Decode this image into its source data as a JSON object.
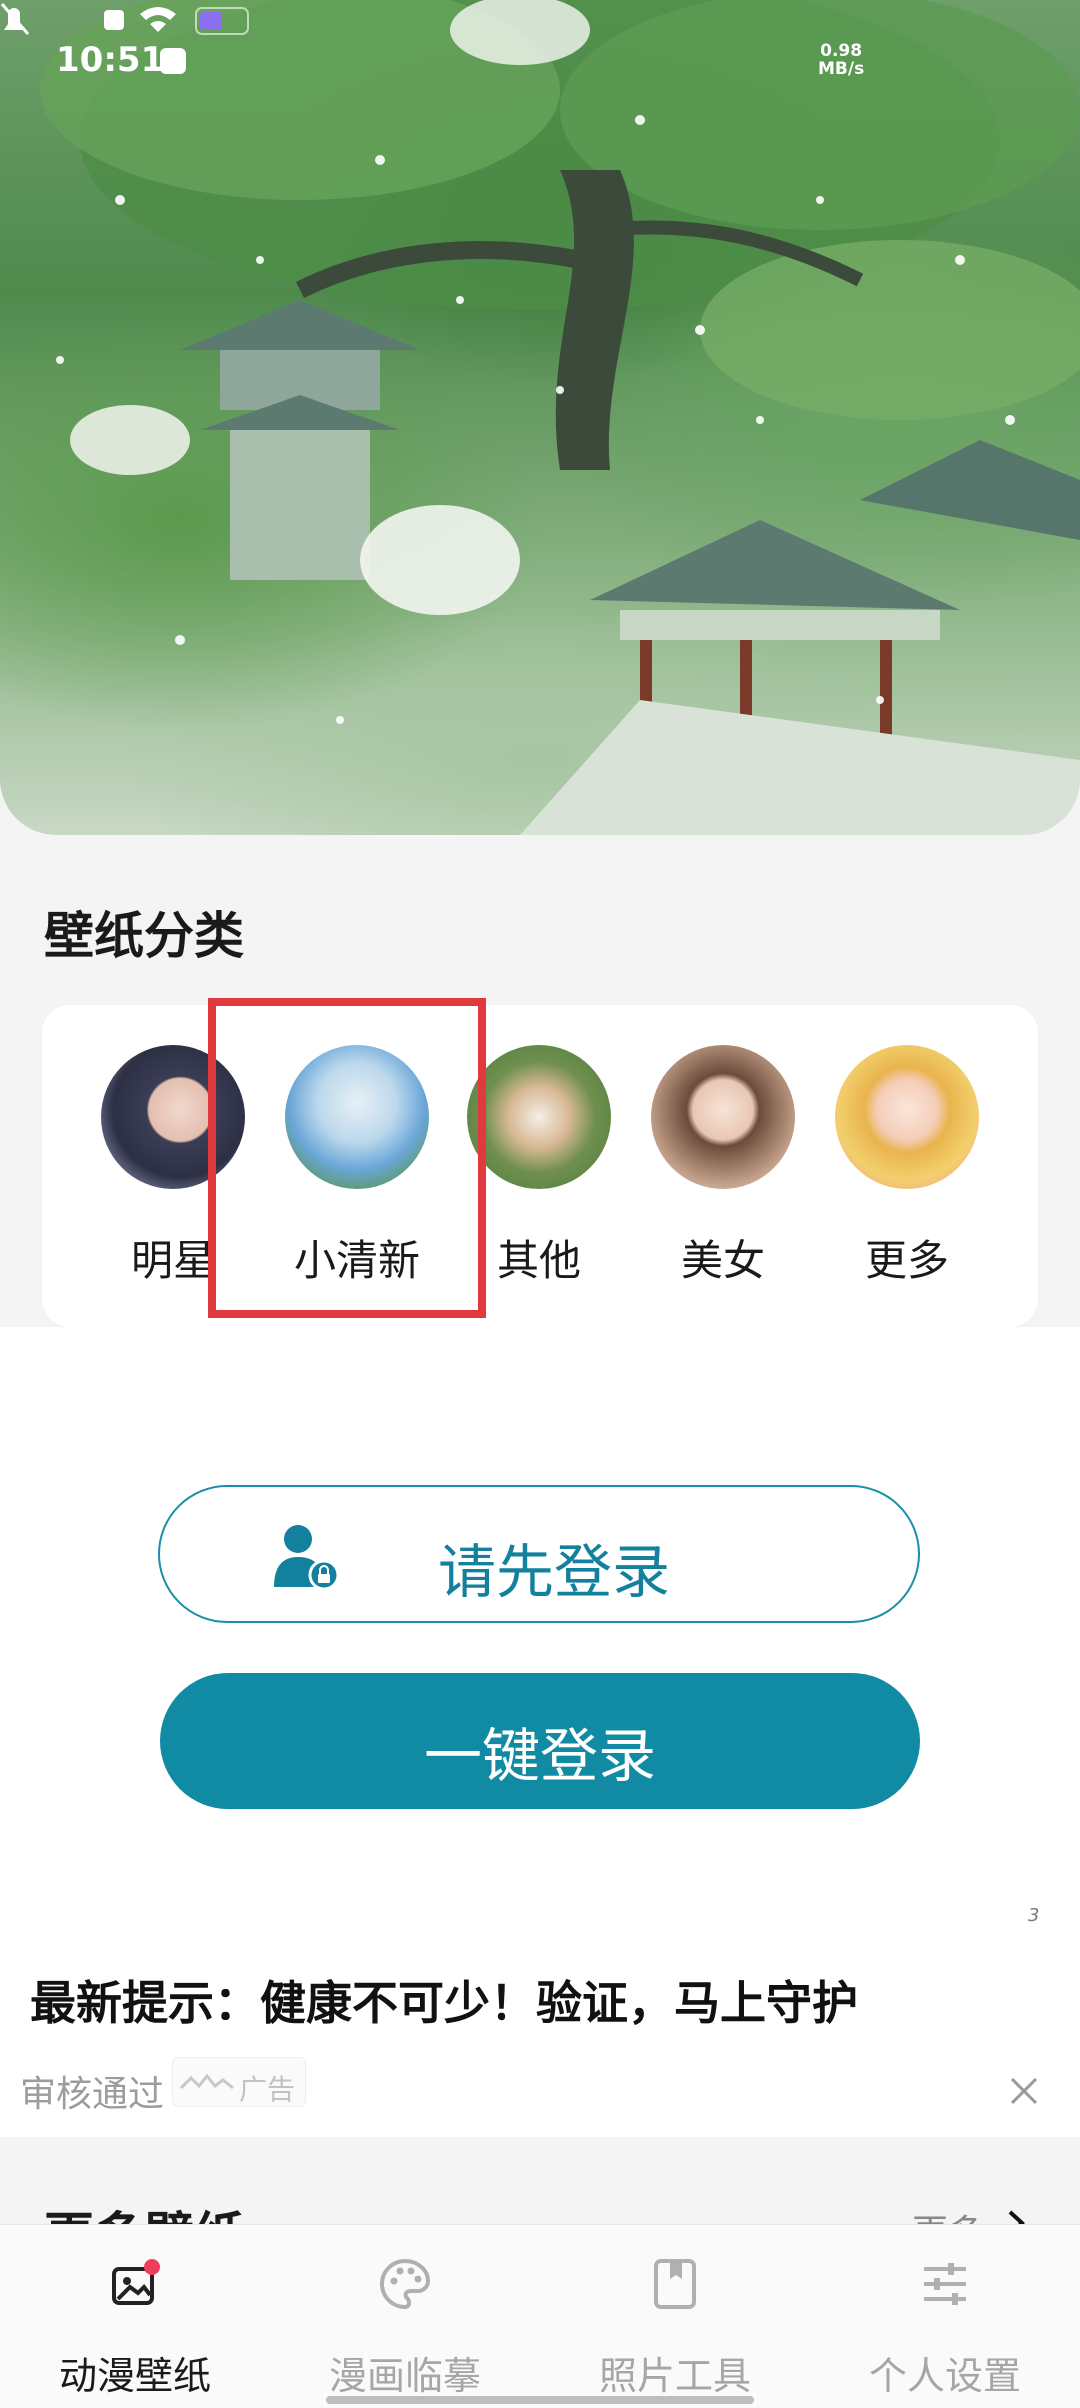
{
  "status_bar": {
    "time": "10:51",
    "net_speed_value": "0.98",
    "net_speed_unit": "MB/s"
  },
  "hero": {
    "image": "ancient-pavilion-under-green-tree-illustration"
  },
  "categories": {
    "title": "壁纸分类",
    "items": [
      {
        "label": "明星",
        "avatar": "anime-boy-portrait"
      },
      {
        "label": "小清新",
        "avatar": "fairy-palace-landscape"
      },
      {
        "label": "其他",
        "avatar": "kitten-in-leaves"
      },
      {
        "label": "美女",
        "avatar": "anime-girl-portrait"
      },
      {
        "label": "更多",
        "avatar": "blonde-anime-girl-with-cat"
      }
    ],
    "highlighted_index": 1
  },
  "login": {
    "login_first_label": "请先登录",
    "one_click_login_label": "一键登录"
  },
  "notice": {
    "text": "最新提示：健康不可少！验证，马上守护",
    "mark": "3"
  },
  "ad": {
    "text": "审核通过",
    "badge_label": "广告"
  },
  "more_section": {
    "title": "更多壁纸",
    "link_label": "更多"
  },
  "tab_bar": {
    "items": [
      {
        "label": "动漫壁纸",
        "icon": "wallpaper-icon",
        "active": true
      },
      {
        "label": "漫画临摹",
        "icon": "palette-icon",
        "active": false
      },
      {
        "label": "照片工具",
        "icon": "bookmark-book-icon",
        "active": false
      },
      {
        "label": "个人设置",
        "icon": "sliders-icon",
        "active": false
      }
    ]
  },
  "colors": {
    "accent": "#118aa3",
    "highlight": "#e0393e",
    "badge": "#f03d5c"
  }
}
